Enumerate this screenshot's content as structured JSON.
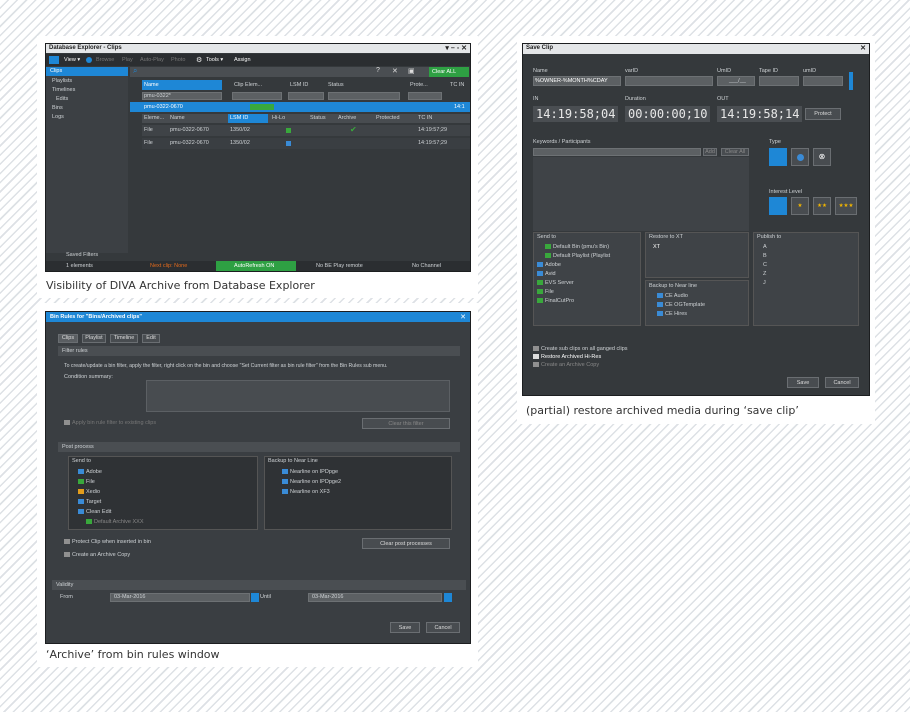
{
  "captions": {
    "c1": "Visibility of DIVA Archive from Database Explorer",
    "c2": "(partial) restore archived media during ‘save clip’",
    "c3": "‘Archive’ from bin rules window"
  },
  "db": {
    "title": "Database Explorer - Clips",
    "toolbar": [
      "View ▾",
      "Browse",
      "Play",
      "Auto-Play",
      "Photo",
      "Tools ▾",
      "Assign"
    ],
    "clear_all": "Clear ALL",
    "tree": [
      "Clips",
      "Playlists",
      "Timelines",
      "Edits",
      "Bins",
      "Logs"
    ],
    "columns": [
      "Name",
      "Clip Elem...",
      "LSM ID",
      "Status",
      "Prote...",
      "TC IN"
    ],
    "filter_name": "pmu-0322*",
    "group_row": "pmu-0322-0670",
    "group_tc": "14:1",
    "sub_columns": [
      "Eleme...",
      "Name",
      "LSM ID",
      "Hi-Lo",
      "Status",
      "Archive",
      "Protected",
      "TC IN"
    ],
    "rows": [
      {
        "type": "File",
        "name": "pmu-0322-0670",
        "lsm": "1350/02",
        "tc": "14:19:57;29"
      },
      {
        "type": "File",
        "name": "pmu-0322-0670",
        "lsm": "1350/02",
        "tc": "14:19:57;29"
      }
    ],
    "saved_filters": "Saved Filters",
    "status": [
      "1 elements",
      "Next clip: None",
      "AutoRefresh ON",
      "No BE Play remote",
      "No Channel"
    ]
  },
  "save": {
    "title": "Save Clip",
    "labels": [
      "Name",
      "varID",
      "UmID",
      "Tape ID",
      "umID"
    ],
    "name_value": "%OWNER-%MONTH%CDAY",
    "umid_value": "___/__",
    "in_label": "IN",
    "dur_label": "Duration",
    "out_label": "OUT",
    "tc_in": "14:19:58;04",
    "tc_dur": "00:00:00;10",
    "tc_out": "14:19:58;14",
    "protect": "Protect",
    "kw_label": "Keywords / Participants",
    "add": "Add",
    "clear_all": "Clear All",
    "type_label": "Type",
    "interest_label": "Interest Level",
    "stars": [
      "★",
      "★★",
      "★★★"
    ],
    "send_to": "Send to",
    "send_items": [
      "Default Bin (pmu's Bin)",
      "Default Playlist (Playlist",
      "Adobe",
      "Avid",
      "EVS Server",
      "File",
      "FinalCutPro"
    ],
    "restore_to": "Restore to XT",
    "restore_items": [
      "XT"
    ],
    "backup": "Backup to Near line",
    "backup_items": [
      "CE Audio",
      "CE OGTemplate",
      "CE Hires"
    ],
    "publish": "Publish to",
    "publish_items": [
      "A",
      "B",
      "C",
      "Z",
      "J"
    ],
    "checks": [
      "Create sub clips on all ganged clips",
      "Restore Archived Hi-Res",
      "Create an Archive Copy"
    ],
    "save_btn": "Save",
    "cancel_btn": "Cancel"
  },
  "bin": {
    "title": "Bin Rules for \"Bins/Archived clips\"",
    "tabs": [
      "Clips",
      "Playlist",
      "Timeline",
      "Edit"
    ],
    "filter_rules": "Filter rules",
    "hint": "To create/update a bin filter, apply the filter, right click on the bin and choose \"Set Current filter as bin rule filter\" from the Bin Rules sub menu.",
    "condition": "Condition summary:",
    "apply": "Apply bin rule filter to existing clips",
    "clear_filter": "Clear this filter",
    "post": "Post process",
    "send_to": "Send to",
    "send_items": [
      "Adobe",
      "File",
      "Xedio",
      "Target",
      "Clean Edit",
      "Default Archive XXX"
    ],
    "backup": "Backup to Near Line",
    "backup_items": [
      "Nearline on IPDpge",
      "Nearline on IPDpge2",
      "Nearline on XF3"
    ],
    "protect": "Protect Clip when inserted in bin",
    "archive": "Create an Archive Copy",
    "clear_post": "Clear post processes",
    "validity": "Validity",
    "from": "From",
    "from_date": "03-Mar-2016",
    "until": "Until",
    "until_date": "03-Mar-2016",
    "save": "Save",
    "cancel": "Cancel"
  },
  "colors": {
    "accent": "#1e87d6",
    "green": "#2ea043",
    "orange": "#e36a1c",
    "panel": "#35393c"
  }
}
